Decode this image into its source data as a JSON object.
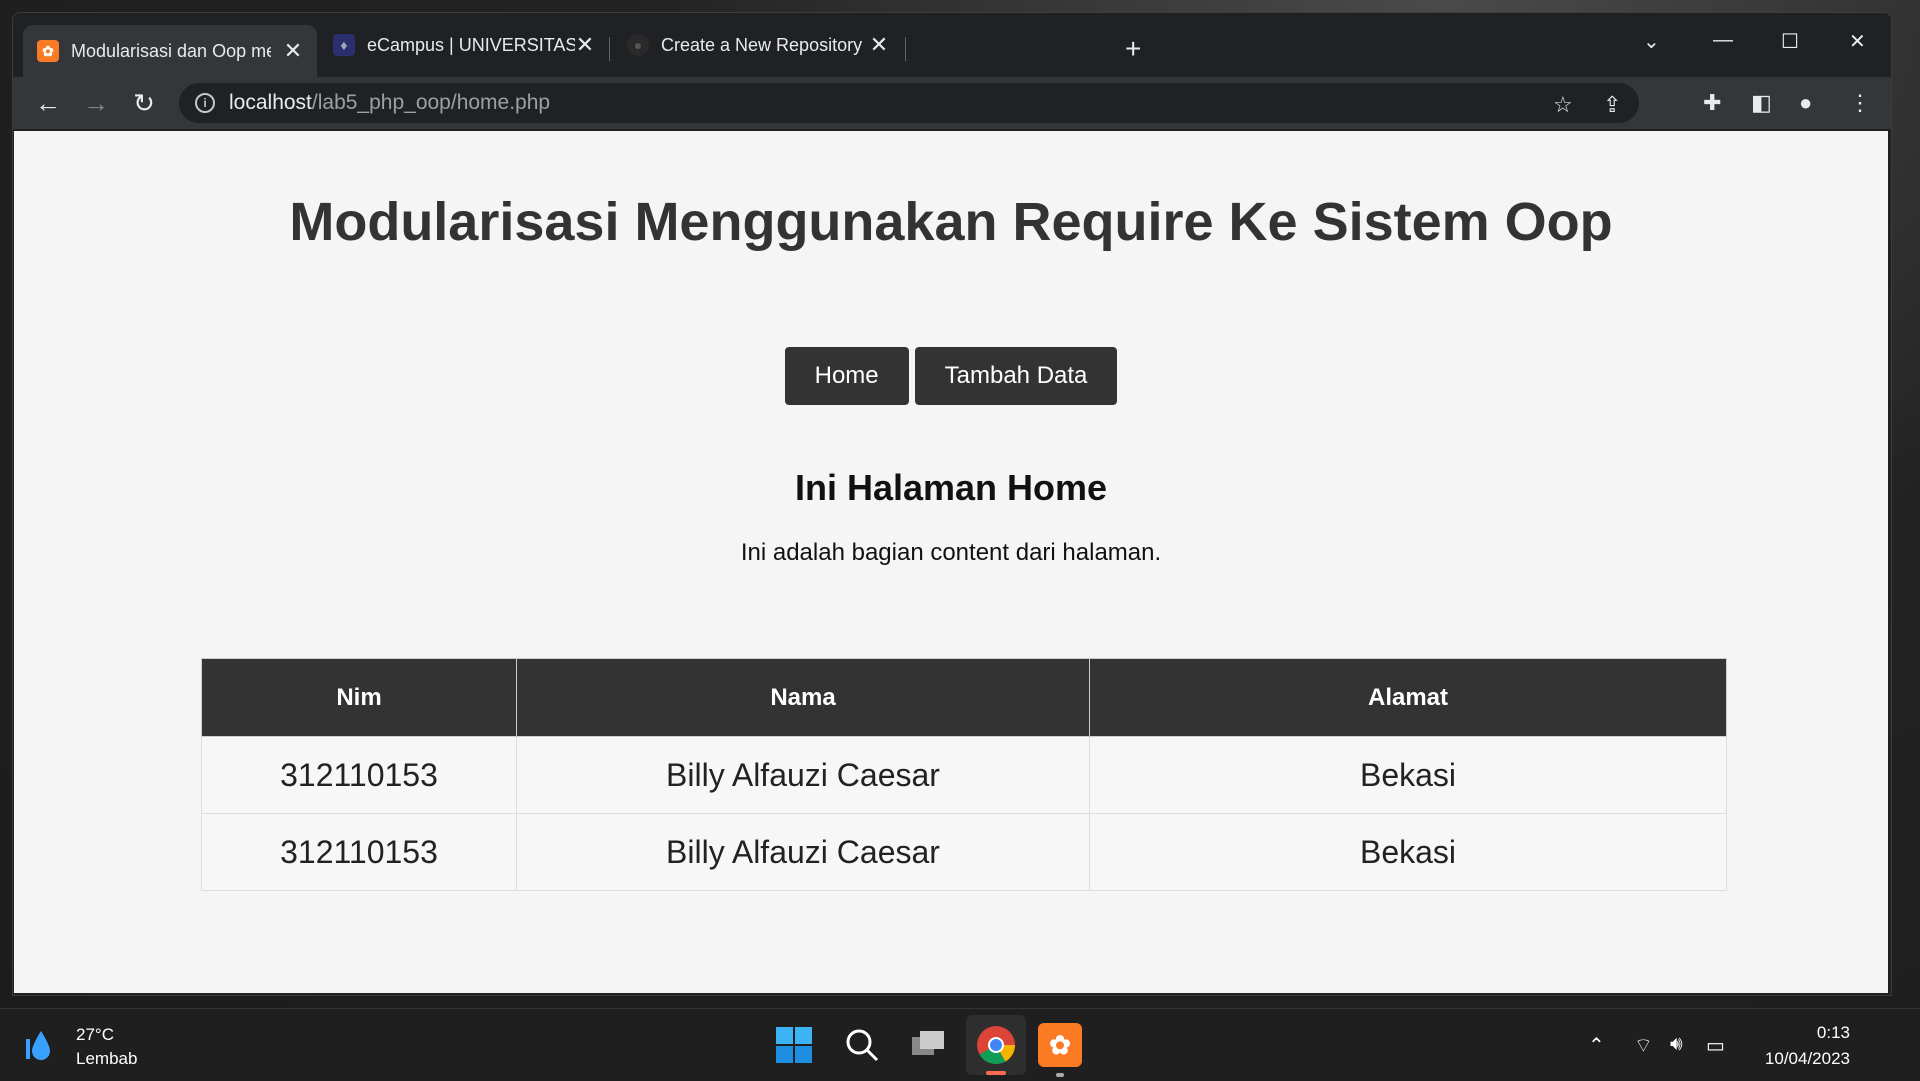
{
  "browser": {
    "tabs": [
      {
        "title": "Modularisasi dan Oop menjadi sa",
        "icon": "xampp-icon"
      },
      {
        "title": "eCampus | UNIVERSITAS PELITA B",
        "icon": "campus-icon"
      },
      {
        "title": "Create a New Repository",
        "icon": "github-icon"
      }
    ],
    "url_host": "localhost",
    "url_path": "/lab5_php_oop/home.php"
  },
  "page": {
    "title": "Modularisasi Menggunakan Require Ke Sistem Oop",
    "nav": [
      "Home",
      "Tambah Data"
    ],
    "heading": "Ini Halaman Home",
    "content": "Ini adalah bagian content dari halaman.",
    "table": {
      "headers": [
        "Nim",
        "Nama",
        "Alamat"
      ],
      "rows": [
        [
          "312110153",
          "Billy Alfauzi Caesar",
          "Bekasi"
        ],
        [
          "312110153",
          "Billy Alfauzi Caesar",
          "Bekasi"
        ]
      ]
    }
  },
  "taskbar": {
    "weather_temp": "27°C",
    "weather_desc": "Lembab",
    "time": "0:13",
    "date": "10/04/2023"
  },
  "colors": {
    "header_bg": "#333333",
    "page_bg": "#f5f5f5",
    "chrome_dark": "#202124",
    "xampp_orange": "#fb7a24"
  }
}
